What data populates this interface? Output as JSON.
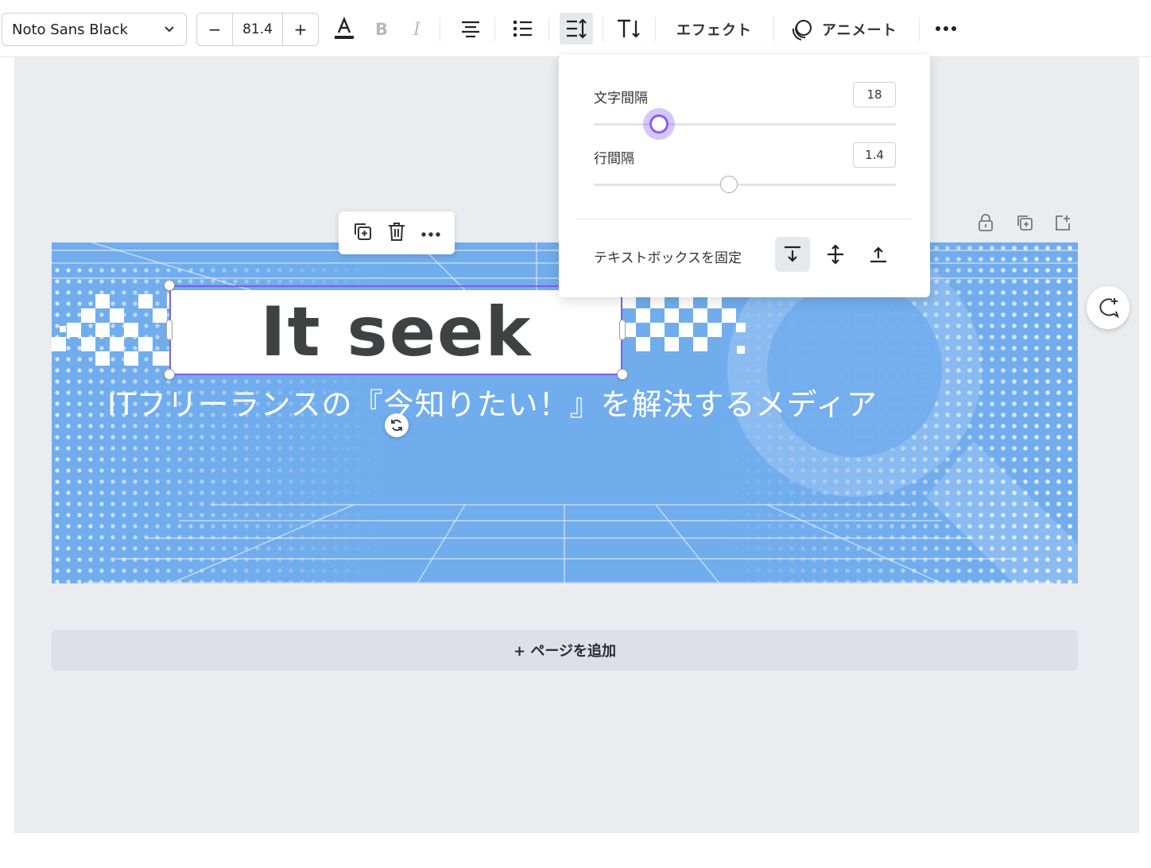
{
  "toolbar": {
    "font_family": "Noto Sans Black",
    "size_decrease": "−",
    "font_size": "81.4",
    "size_increase": "+",
    "effects_label": "エフェクト",
    "animate_label": "アニメート"
  },
  "popover": {
    "letter_spacing_label": "文字間隔",
    "letter_spacing_value": "18",
    "line_spacing_label": "行間隔",
    "line_spacing_value": "1.4",
    "fix_textbox_label": "テキストボックスを固定"
  },
  "design": {
    "headline": "It seek",
    "subtitle": "ITフリーランスの『今知りたい！』を解決するメディア",
    "background_color": "#71aded"
  },
  "add_page_label": "+ ページを追加",
  "colors": {
    "accent": "#8b5cf6",
    "selection": "#7d5df2"
  }
}
